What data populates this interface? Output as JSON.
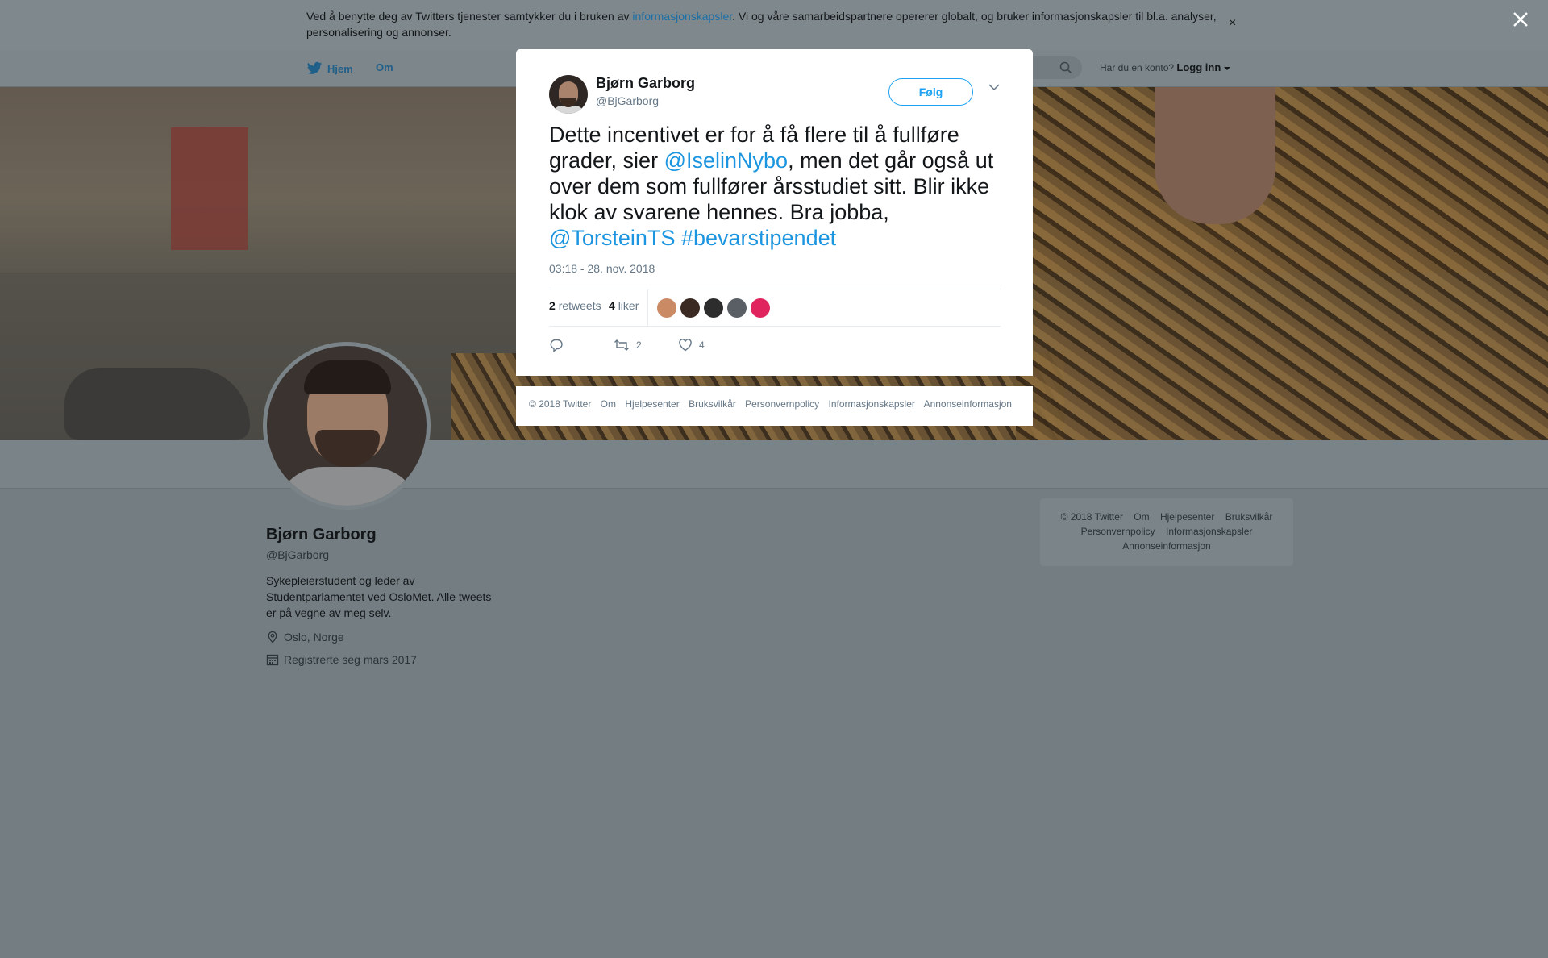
{
  "cookie_banner": {
    "text_before": "Ved å benytte deg av Twitters tjenester samtykker du i bruken av ",
    "link": "informasjonskapsler",
    "text_after": ". Vi og våre samarbeidspartnere opererer globalt, og bruker informasjonskapsler til bl.a. analyser, personalisering og annonser.",
    "close_glyph": "×"
  },
  "nav": {
    "home": "Hjem",
    "about": "Om",
    "account_prompt": "Har du en konto?",
    "login": "Logg inn"
  },
  "profile": {
    "name": "Bjørn Garborg",
    "handle": "@BjGarborg",
    "bio": "Sykepleierstudent og leder av Studentparlamentet ved OsloMet. Alle tweets er på vegne av meg selv.",
    "location": "Oslo, Norge",
    "joined": "Registrerte seg mars 2017"
  },
  "side_footer": {
    "links": [
      "© 2018 Twitter",
      "Om",
      "Hjelpesenter",
      "Bruksvilkår",
      "Personvernpolicy",
      "Informasjonskapsler",
      "Annonseinformasjon"
    ]
  },
  "tweet": {
    "author_name": "Bjørn Garborg",
    "author_handle": "@BjGarborg",
    "follow_label": "Følg",
    "text_1": "Dette incentivet er for å få flere til å fullføre grader, sier ",
    "mention_1": "@IselinNybo",
    "text_2": ", men det går også ut over dem som fullfører årsstudiet sitt. Blir ikke klok av svarene hennes. Bra jobba, ",
    "mention_2": "@TorsteinTS",
    "text_3": " ",
    "hashtag": "#bevarstipendet",
    "timestamp": "03:18 - 28. nov. 2018",
    "retweets_count": "2",
    "retweets_label": "retweets",
    "likes_count": "4",
    "likes_label": "liker",
    "likers_colors": [
      "#c98a64",
      "#3a2a22",
      "#2d2d2d",
      "#5a5f66",
      "#e0245e"
    ],
    "action_retweet_count": "2",
    "action_like_count": "4"
  },
  "modal_footer": {
    "links": [
      "© 2018 Twitter",
      "Om",
      "Hjelpesenter",
      "Bruksvilkår",
      "Personvernpolicy",
      "Informasjonskapsler",
      "Annonseinformasjon"
    ]
  },
  "colors": {
    "accent": "#1da1f2",
    "link": "#1b95e0",
    "overlay": "#737d82"
  },
  "icons": [
    "twitter-bird-icon",
    "search-icon",
    "caret-down-icon",
    "location-pin-icon",
    "calendar-icon",
    "reply-icon",
    "retweet-icon",
    "heart-icon",
    "close-icon"
  ]
}
